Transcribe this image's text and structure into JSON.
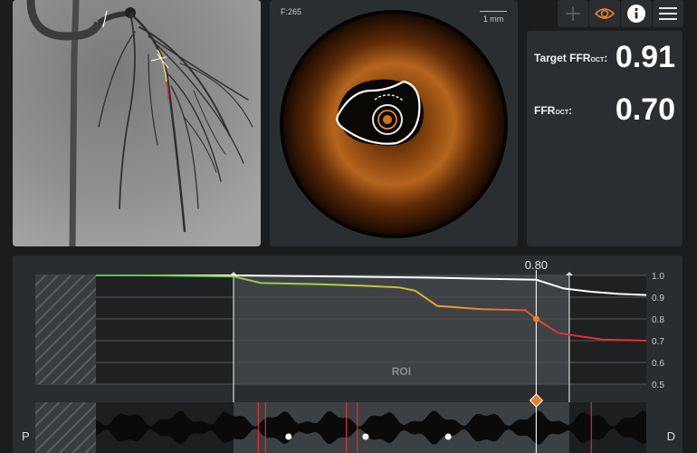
{
  "toolbar": {
    "plus": "plus-icon",
    "eye": "eye-icon",
    "info": "info-icon",
    "menu": "menu-icon",
    "accent": "#e8812a"
  },
  "oct_view": {
    "frame": "F:265",
    "scale": "1 mm"
  },
  "ffr_panel": {
    "target_label": "Target FFR",
    "target_sub": "OCT",
    "target_suffix": ":",
    "target_value": "0.91",
    "ffr_label": "FFR",
    "ffr_sub": "OCT",
    "ffr_suffix": ":",
    "ffr_value": "0.70"
  },
  "graph": {
    "cursor_value": "0.80",
    "roi_label": "ROI",
    "y_ticks": [
      "1.0",
      "0.9",
      "0.8",
      "0.7",
      "0.6",
      "0.5"
    ],
    "left_end": "P",
    "right_end": "D"
  },
  "chart_data": {
    "type": "line",
    "ylim": [
      0.5,
      1.0
    ],
    "xlim": [
      0,
      100
    ],
    "series": [
      {
        "color": "#ffffff",
        "x": [
          0,
          25,
          45,
          60,
          70,
          80,
          85,
          90,
          95,
          100
        ],
        "y": [
          1.0,
          1.0,
          0.995,
          0.99,
          0.985,
          0.98,
          0.94,
          0.925,
          0.915,
          0.91
        ]
      },
      {
        "color_scale": [
          "#4cc84c",
          "#b8d040",
          "#e8a030",
          "#e03030"
        ],
        "x": [
          0,
          10,
          25,
          30,
          40,
          48,
          55,
          58,
          62,
          70,
          78,
          80,
          84,
          88,
          92,
          100
        ],
        "y": [
          1.0,
          1.0,
          0.995,
          0.965,
          0.96,
          0.953,
          0.945,
          0.93,
          0.86,
          0.845,
          0.84,
          0.8,
          0.735,
          0.72,
          0.705,
          0.7
        ]
      }
    ],
    "roi_x": [
      25,
      86
    ],
    "cursor_x": 80
  },
  "lumen_profile": {
    "markers_x": [
      35,
      49,
      64
    ],
    "red_lines_x": [
      29.5,
      30.8,
      45.5,
      47.5,
      90
    ]
  }
}
